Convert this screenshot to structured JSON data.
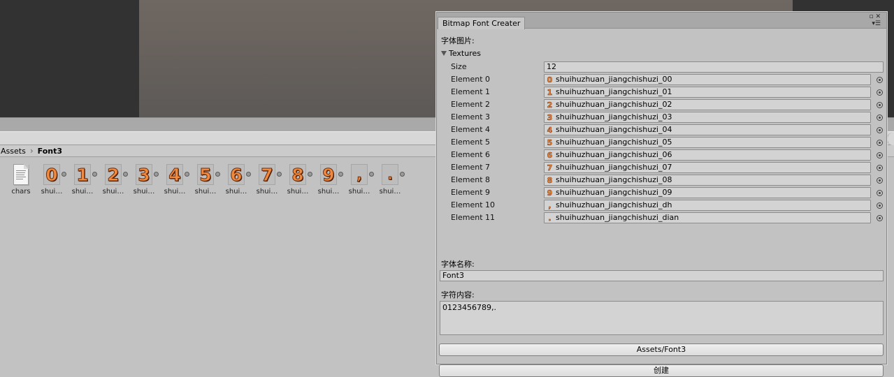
{
  "breadcrumb": {
    "root": "Assets",
    "current": "Font3"
  },
  "assets": [
    {
      "label": "chars",
      "kind": "text-file",
      "glyph": ""
    },
    {
      "label": "shui…",
      "kind": "sprite",
      "glyph": "0"
    },
    {
      "label": "shui…",
      "kind": "sprite",
      "glyph": "1"
    },
    {
      "label": "shui…",
      "kind": "sprite",
      "glyph": "2"
    },
    {
      "label": "shui…",
      "kind": "sprite",
      "glyph": "3"
    },
    {
      "label": "shui…",
      "kind": "sprite",
      "glyph": "4"
    },
    {
      "label": "shui…",
      "kind": "sprite",
      "glyph": "5"
    },
    {
      "label": "shui…",
      "kind": "sprite",
      "glyph": "6"
    },
    {
      "label": "shui…",
      "kind": "sprite",
      "glyph": "7"
    },
    {
      "label": "shui…",
      "kind": "sprite",
      "glyph": "8"
    },
    {
      "label": "shui…",
      "kind": "sprite",
      "glyph": "9"
    },
    {
      "label": "shui…",
      "kind": "sprite",
      "glyph": ","
    },
    {
      "label": "shui…",
      "kind": "sprite",
      "glyph": "."
    }
  ],
  "window": {
    "tab_title": "Bitmap Font Creater",
    "font_image_label": "字体图片:",
    "textures_label": "Textures",
    "size_label": "Size",
    "size_value": "12",
    "elements": [
      {
        "label": "Element 0",
        "value": "shuihuzhuan_jiangchishuzi_00",
        "glyph": "0"
      },
      {
        "label": "Element 1",
        "value": "shuihuzhuan_jiangchishuzi_01",
        "glyph": "1"
      },
      {
        "label": "Element 2",
        "value": "shuihuzhuan_jiangchishuzi_02",
        "glyph": "2"
      },
      {
        "label": "Element 3",
        "value": "shuihuzhuan_jiangchishuzi_03",
        "glyph": "3"
      },
      {
        "label": "Element 4",
        "value": "shuihuzhuan_jiangchishuzi_04",
        "glyph": "4"
      },
      {
        "label": "Element 5",
        "value": "shuihuzhuan_jiangchishuzi_05",
        "glyph": "5"
      },
      {
        "label": "Element 6",
        "value": "shuihuzhuan_jiangchishuzi_06",
        "glyph": "6"
      },
      {
        "label": "Element 7",
        "value": "shuihuzhuan_jiangchishuzi_07",
        "glyph": "7"
      },
      {
        "label": "Element 8",
        "value": "shuihuzhuan_jiangchishuzi_08",
        "glyph": "8"
      },
      {
        "label": "Element 9",
        "value": "shuihuzhuan_jiangchishuzi_09",
        "glyph": "9"
      },
      {
        "label": "Element 10",
        "value": "shuihuzhuan_jiangchishuzi_dh",
        "glyph": ","
      },
      {
        "label": "Element 11",
        "value": "shuihuzhuan_jiangchishuzi_dian",
        "glyph": "."
      }
    ],
    "font_name_label": "字体名称:",
    "font_name_value": "Font3",
    "chars_label": "字符内容:",
    "chars_value": "0123456789,.",
    "path_button": "Assets/Font3",
    "create_button": "创建"
  },
  "colors": {
    "glyph_fill": "#f08a3e",
    "glyph_outline": "#6b2c0c",
    "editor_bg": "#c2c2c2"
  }
}
